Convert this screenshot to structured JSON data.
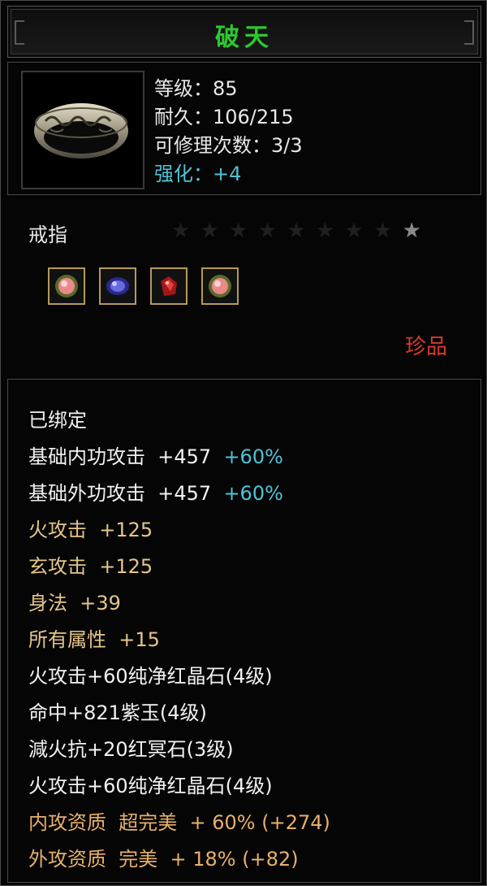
{
  "item": {
    "name": "破天",
    "stats": {
      "level": "等级：85",
      "durability": "耐久：106/215",
      "repairs": "可修理次数：3/3",
      "enhance": "强化：+4"
    },
    "type": "戒指",
    "stars_total": 9,
    "stars_lit": 1,
    "rarity": "珍品",
    "gems": [
      "red-crystal-gem",
      "purple-jade-gem",
      "red-ming-gem",
      "red-crystal-gem"
    ]
  },
  "attributes": [
    {
      "text": "已绑定",
      "extra": ""
    },
    {
      "text": "基础内功攻击  +457  ",
      "extra": "+60%"
    },
    {
      "text": "基础外功攻击  +457  ",
      "extra": "+60%"
    },
    {
      "text": "火攻击  +125",
      "extra": ""
    },
    {
      "text": "玄攻击  +125",
      "extra": ""
    },
    {
      "text": "身法  +39",
      "extra": ""
    },
    {
      "text": "所有属性  +15",
      "extra": ""
    },
    {
      "text": "火攻击+60纯净红晶石(4级)",
      "extra": ""
    },
    {
      "text": "命中+821紫玉(4级)",
      "extra": ""
    },
    {
      "text": "減火抗+20红冥石(3级)",
      "extra": ""
    },
    {
      "text": "火攻击+60纯净红晶石(4级)",
      "extra": ""
    },
    {
      "text": "内攻资质  超完美  + 60% (+274)",
      "extra": ""
    },
    {
      "text": "外攻资质  完美  + 18% (+82)",
      "extra": ""
    }
  ],
  "colors": {
    "title": "#2ec82e",
    "white": "#f2f2f2",
    "yellow": "#e4c68a",
    "orange": "#e8b06a",
    "cyan": "#4fc3d6",
    "rarity": "#d83a2a"
  }
}
